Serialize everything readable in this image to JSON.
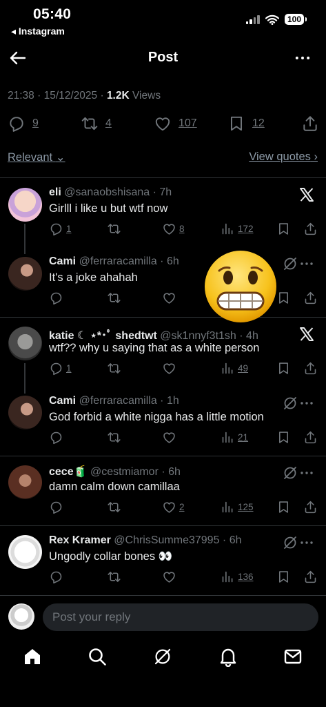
{
  "status_bar": {
    "time": "05:40",
    "back_app": "◂ Instagram",
    "battery": "100"
  },
  "header": {
    "title": "Post"
  },
  "post_meta": {
    "time": "21:38",
    "date": "15/12/2025",
    "views_count": "1.2K",
    "views_label": "Views"
  },
  "post_stats": {
    "replies": "9",
    "reposts": "4",
    "likes": "107",
    "bookmarks": "12"
  },
  "sort": {
    "relevance": "Relevant",
    "view_quotes": "View quotes"
  },
  "replies": [
    {
      "name": "eli",
      "handle": "@sanaobshisana",
      "time": "7h",
      "text": "Girlll i like u but wtf now",
      "replies": "1",
      "reposts": "",
      "likes": "8",
      "views": "172",
      "corner": "x-logo"
    },
    {
      "name": "Cami",
      "handle": "@ferraracamilla",
      "time": "6h",
      "text": "It's a joke ahahah",
      "replies": "",
      "reposts": "",
      "likes": "",
      "views": "",
      "corner": "grok-icon"
    },
    {
      "name": "katie ☾ ⋆*･ﾟ shedtwt",
      "handle": "@sk1nnyf3t1sh",
      "time": "4h",
      "text": "wtf?? why u saying that as a white person",
      "replies": "1",
      "reposts": "",
      "likes": "",
      "views": "49",
      "corner": "x-logo"
    },
    {
      "name": "Cami",
      "handle": "@ferraracamilla",
      "time": "1h",
      "text": "God forbid a white nigga has a little motion",
      "replies": "",
      "reposts": "",
      "likes": "",
      "views": "21",
      "corner": "grok-icon"
    },
    {
      "name": "cece🧃",
      "handle": "@cestmiamor",
      "time": "6h",
      "text": "damn calm down camillaa",
      "replies": "",
      "reposts": "",
      "likes": "2",
      "views": "125",
      "corner": "grok-icon"
    },
    {
      "name": "Rex Kramer",
      "handle": "@ChrisSumme37995",
      "time": "6h",
      "text": "Ungodly collar bones 👀",
      "replies": "",
      "reposts": "",
      "likes": "",
      "views": "136",
      "corner": "grok-icon"
    }
  ],
  "compose": {
    "placeholder": "Post your reply"
  },
  "colors": {
    "background": "#000000",
    "muted": "#71767b",
    "text": "#e7e9ea",
    "divider": "#2f3336"
  }
}
